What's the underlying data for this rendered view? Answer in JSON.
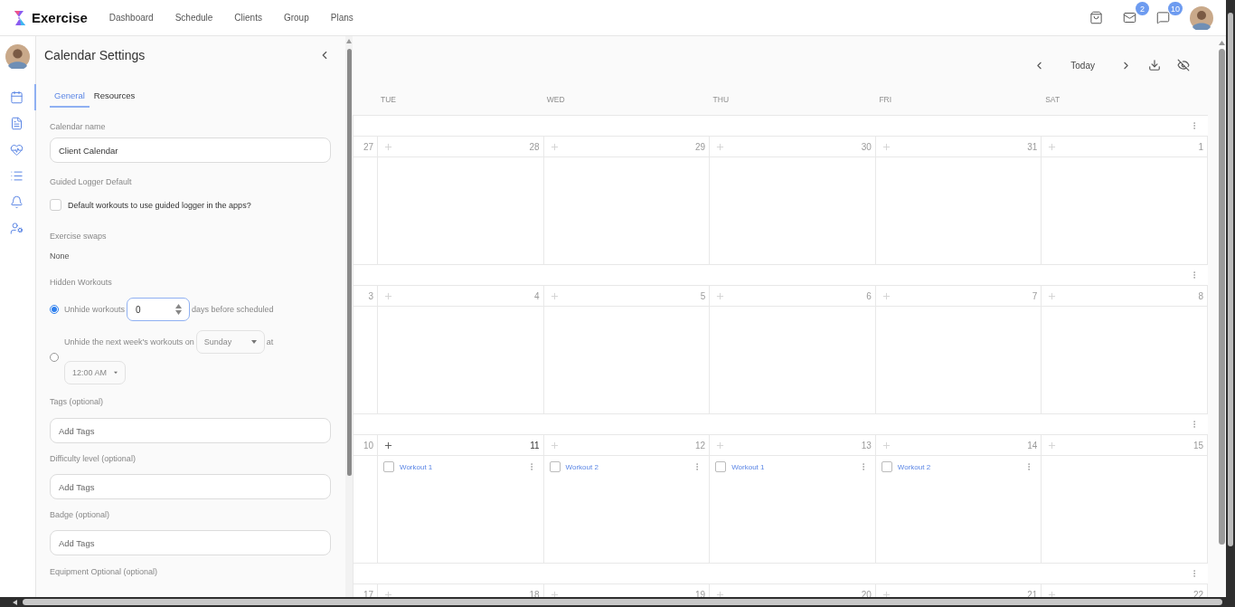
{
  "app": {
    "name": "Exercise"
  },
  "nav": [
    "Dashboard",
    "Schedule",
    "Clients",
    "Group",
    "Plans"
  ],
  "header": {
    "mail_badge": "2",
    "chat_badge": "10"
  },
  "rail": [
    {
      "selected": true
    },
    {
      "selected": false
    },
    {
      "selected": false
    },
    {
      "selected": false
    },
    {
      "selected": false
    },
    {
      "selected": false
    }
  ],
  "settings": {
    "title": "Calendar Settings",
    "tabs": [
      {
        "label": "General",
        "selected": true
      },
      {
        "label": "Resources",
        "selected": false
      }
    ],
    "calendar_name": {
      "label": "Calendar name",
      "value": "Client Calendar"
    },
    "guided_logger": {
      "label": "Guided Logger Default",
      "checkbox_label": "Default workouts to use guided logger in the apps?",
      "checked": false
    },
    "exercise_swaps": {
      "label": "Exercise swaps",
      "value": "None"
    },
    "hidden_workouts": {
      "label": "Hidden Workouts",
      "options": [
        {
          "kind": "days",
          "selected": true,
          "before": "Unhide workouts",
          "value": "0",
          "after": "days before scheduled"
        },
        {
          "kind": "weekly",
          "selected": false,
          "before": "Unhide the next week's workouts on",
          "day": "Sunday",
          "after": "at",
          "time": "12:00 AM"
        }
      ]
    },
    "tag_fields": [
      {
        "label": "Tags (optional)",
        "placeholder": "Add Tags"
      },
      {
        "label": "Difficulty level (optional)",
        "placeholder": "Add Tags"
      },
      {
        "label": "Badge (optional)",
        "placeholder": "Add Tags"
      }
    ],
    "last_label": "Equipment Optional (optional)"
  },
  "calendar": {
    "today_button": "Today",
    "weekdays": [
      "TUE",
      "WED",
      "THU",
      "FRI",
      "SAT"
    ],
    "weeks": [
      {
        "lead": "27",
        "days": [
          {
            "number": "28",
            "today": false
          },
          {
            "number": "29",
            "today": false
          },
          {
            "number": "30",
            "today": false
          },
          {
            "number": "31",
            "today": false
          },
          {
            "number": "1",
            "today": false
          }
        ]
      },
      {
        "lead": "3",
        "days": [
          {
            "number": "4",
            "today": false
          },
          {
            "number": "5",
            "today": false
          },
          {
            "number": "6",
            "today": false
          },
          {
            "number": "7",
            "today": false
          },
          {
            "number": "8",
            "today": false
          }
        ]
      },
      {
        "lead": "10",
        "days": [
          {
            "number": "11",
            "today": true,
            "events": [
              {
                "title": "Workout 1",
                "done": false
              }
            ]
          },
          {
            "number": "12",
            "today": false,
            "events": [
              {
                "title": "Workout 2",
                "done": false
              }
            ]
          },
          {
            "number": "13",
            "today": false,
            "events": [
              {
                "title": "Workout 1",
                "done": false
              }
            ]
          },
          {
            "number": "14",
            "today": false,
            "events": [
              {
                "title": "Workout 2",
                "done": false
              }
            ]
          },
          {
            "number": "15",
            "today": false
          }
        ]
      },
      {
        "lead": "17",
        "days": [
          {
            "number": "18",
            "today": false
          },
          {
            "number": "19",
            "today": false
          },
          {
            "number": "20",
            "today": false
          },
          {
            "number": "21",
            "today": false
          },
          {
            "number": "22",
            "today": false
          }
        ]
      }
    ]
  }
}
